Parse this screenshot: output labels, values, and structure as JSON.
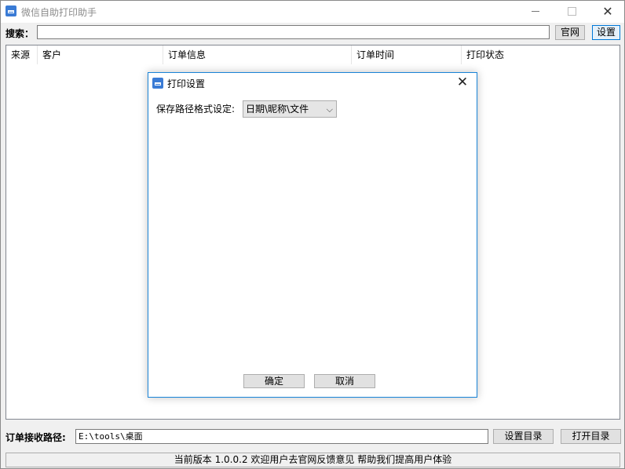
{
  "window": {
    "title": "微信自助打印助手",
    "icon": "printer-icon"
  },
  "search": {
    "label": "搜索：",
    "value": "",
    "website_button": "官网",
    "settings_button": "设置"
  },
  "table": {
    "columns": [
      "来源",
      "客户",
      "订单信息",
      "订单时间",
      "打印状态"
    ],
    "rows": []
  },
  "dialog": {
    "title": "打印设置",
    "format_label": "保存路径格式设定:",
    "format_value": "日期\\昵称\\文件",
    "ok_button": "确定",
    "cancel_button": "取消"
  },
  "footer": {
    "path_label": "订单接收路径:",
    "path_value": "E:\\tools\\桌面",
    "set_dir_button": "设置目录",
    "open_dir_button": "打开目录"
  },
  "status": {
    "text": "当前版本 1.0.0.2 欢迎用户去官网反馈意见 帮助我们提高用户体验"
  },
  "colors": {
    "accent": "#0078d7",
    "dialog_border": "#1883d7",
    "app_icon": "#3a7bd5"
  }
}
